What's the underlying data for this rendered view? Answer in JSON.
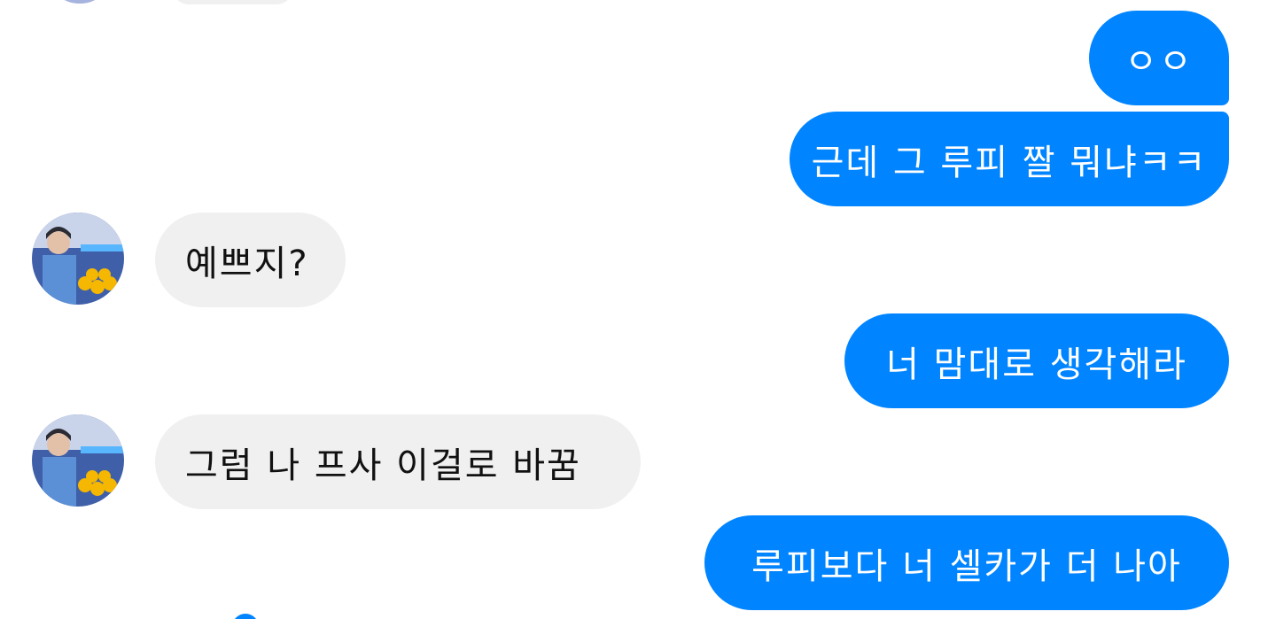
{
  "colors": {
    "sent_bubble": "#0084ff",
    "received_bubble": "#f0f0f0",
    "background": "#ffffff"
  },
  "messages": [
    {
      "side": "sent",
      "text": "ㅇㅇ"
    },
    {
      "side": "sent",
      "text": "근데 그 루피 짤 뭐냐ㅋㅋ"
    },
    {
      "side": "received",
      "text": "예쁘지?"
    },
    {
      "side": "sent",
      "text": "너 맘대로 생각해라"
    },
    {
      "side": "received",
      "text": "그럼 나 프사 이걸로 바꿈"
    },
    {
      "side": "sent",
      "text": "루피보다 너 셀카가 더 나아"
    }
  ]
}
